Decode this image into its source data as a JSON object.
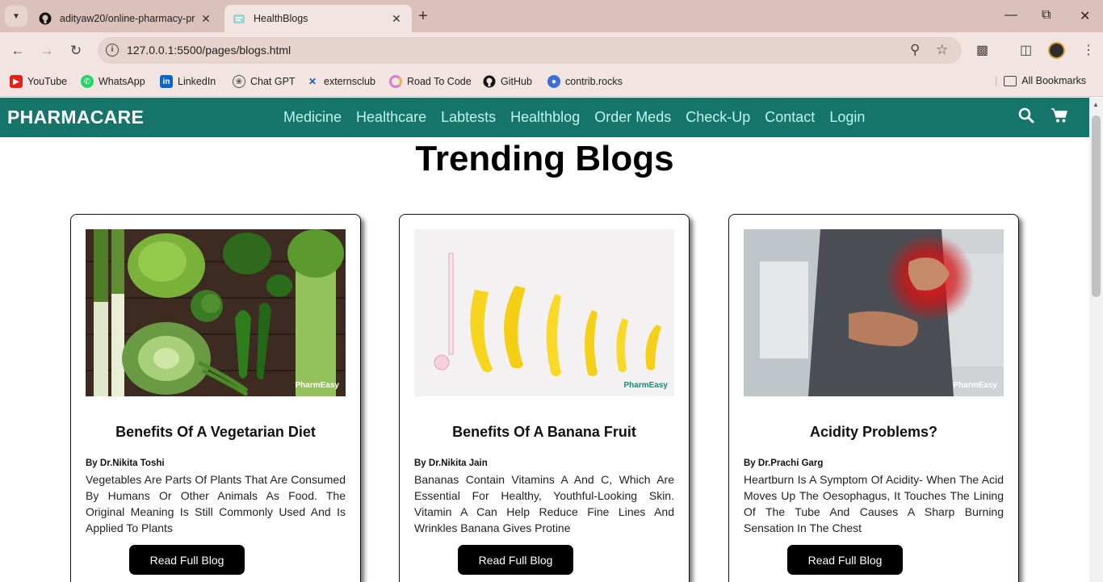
{
  "browser": {
    "tabs": [
      {
        "title": "adityaw20/online-pharmacy-pr",
        "active": false
      },
      {
        "title": "HealthBlogs",
        "active": true
      }
    ],
    "url": "127.0.0.1:5500/pages/blogs.html",
    "bookmarks": [
      {
        "label": "YouTube",
        "icon": "youtube-icon"
      },
      {
        "label": "WhatsApp",
        "icon": "whatsapp-icon"
      },
      {
        "label": "LinkedIn",
        "icon": "linkedin-icon"
      },
      {
        "label": "Chat GPT",
        "icon": "chatgpt-icon"
      },
      {
        "label": "externsclub",
        "icon": "externsclub-icon"
      },
      {
        "label": "Road To Code",
        "icon": "roadtocode-icon"
      },
      {
        "label": "GitHub",
        "icon": "github-icon"
      },
      {
        "label": "contrib.rocks",
        "icon": "contrib-icon"
      }
    ],
    "all_bookmarks": "All Bookmarks"
  },
  "site": {
    "brand": "PHARMACARE",
    "menu": [
      "Medicine",
      "Healthcare",
      "Labtests",
      "Healthblog",
      "Order Meds",
      "Check-Up",
      "Contact",
      "Login"
    ],
    "colors": {
      "nav": "#16756b",
      "menu_text": "#bff4ec"
    }
  },
  "page": {
    "heading": "Trending Blogs",
    "cards": [
      {
        "title": "Benefits Of A Vegetarian Diet",
        "author": "By Dr.Nikita Toshi",
        "description": "Vegetables Are Parts Of Plants That Are Consumed By Humans Or Other Animals As Food. The Original Meaning Is Still Commonly Used And Is Applied To Plants",
        "button": "Read Full Blog",
        "watermark": "PharmEasy"
      },
      {
        "title": "Benefits Of A Banana Fruit",
        "author": "By Dr.Nikita Jain",
        "description": "Bananas Contain Vitamins A And C, Which Are Essential For Healthy, Youthful-Looking Skin. Vitamin A Can Help Reduce Fine Lines And Wrinkles Banana Gives Protine",
        "button": "Read Full Blog",
        "watermark": "PharmEasy"
      },
      {
        "title": "Acidity Problems?",
        "author": "By Dr.Prachi Garg",
        "description": "Heartburn Is A Symptom Of Acidity- When The Acid Moves Up The Oesophagus, It Touches The Lining Of The Tube And Causes A Sharp Burning Sensation In The Chest",
        "button": "Read Full Blog",
        "watermark": "PharmEasy"
      }
    ]
  }
}
